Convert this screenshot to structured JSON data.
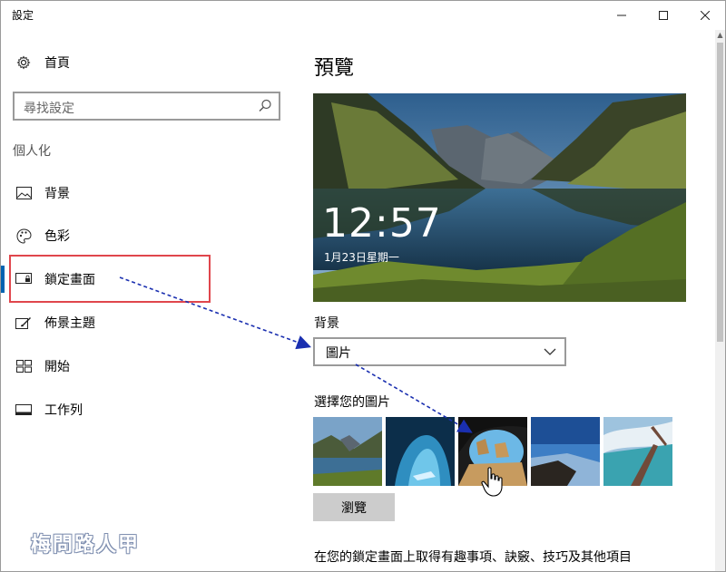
{
  "window": {
    "title": "設定",
    "minimize_glyph": "—",
    "maximize_glyph": "☐",
    "close_glyph": "✕"
  },
  "sidebar": {
    "home": {
      "label": "首頁",
      "icon": "gear-icon"
    },
    "search": {
      "placeholder": "尋找設定",
      "icon": "search-icon"
    },
    "section_title": "個人化",
    "items": [
      {
        "label": "背景",
        "icon": "picture-icon"
      },
      {
        "label": "色彩",
        "icon": "palette-icon"
      },
      {
        "label": "鎖定畫面",
        "icon": "lock-screen-icon"
      },
      {
        "label": "佈景主題",
        "icon": "brush-icon"
      },
      {
        "label": "開始",
        "icon": "start-icon"
      },
      {
        "label": "工作列",
        "icon": "taskbar-icon"
      }
    ],
    "selected_index": 2
  },
  "main": {
    "title": "預覽",
    "preview": {
      "time": "12:57",
      "date": "1月23日星期一"
    },
    "background": {
      "label": "背景",
      "selected": "圖片"
    },
    "choose_picture": {
      "label": "選擇您的圖片",
      "thumbnails": [
        "lake-mountains",
        "ice-cave",
        "beach-arch",
        "coastal-cliff",
        "aerial-coast"
      ]
    },
    "browse_label": "瀏覽",
    "fun_facts_text": "在您的鎖定畫面上取得有趣事項、訣竅、技巧及其他項目"
  },
  "watermark": "梅問路人甲",
  "colors": {
    "accent": "#0063b1",
    "highlight_box": "#e0464c",
    "annotation_arrow": "#1a2fb0"
  }
}
